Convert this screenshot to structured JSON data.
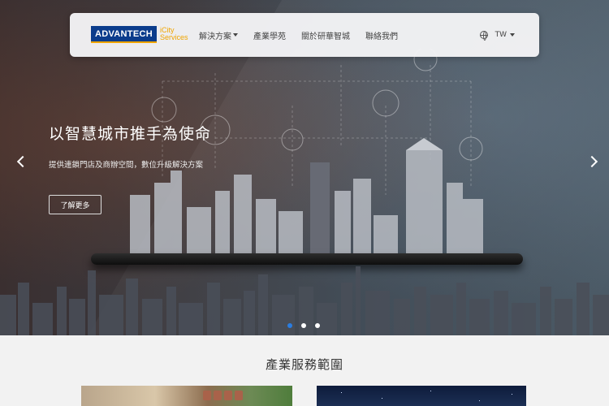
{
  "navbar": {
    "logo": {
      "brand": "ADVANTECH",
      "line1": "iCity",
      "line2": "Services"
    },
    "items": [
      {
        "label": "解決方案",
        "dropdown": true
      },
      {
        "label": "產業學苑",
        "dropdown": false
      },
      {
        "label": "關於研華智城",
        "dropdown": false
      },
      {
        "label": "聯絡我們",
        "dropdown": false
      }
    ],
    "language": {
      "icon": "globe-icon",
      "value": "TW"
    }
  },
  "hero": {
    "title": "以智慧城市推手為使命",
    "subtitle": "提供連鎖門店及商辦空間，數位升級解決方案",
    "button_label": "了解更多",
    "slide_count": 3,
    "active_slide": 1
  },
  "section": {
    "title": "產業服務範圍"
  },
  "colors": {
    "brand": "#0b3c8c",
    "accent": "#f0a500",
    "active_dot": "#2a7de1"
  }
}
